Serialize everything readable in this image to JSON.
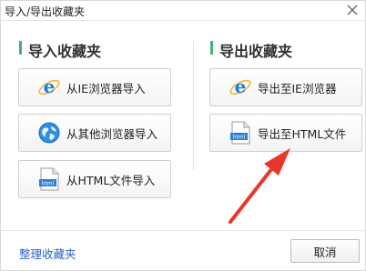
{
  "window": {
    "title": "导入/导出收藏夹"
  },
  "import_section": {
    "title": "导入收藏夹",
    "buttons": [
      {
        "label": "从IE浏览器导入",
        "icon": "ie-browser-icon"
      },
      {
        "label": "从其他浏览器导入",
        "icon": "globe-icon"
      },
      {
        "label": "从HTML文件导入",
        "icon": "html-file-icon"
      }
    ]
  },
  "export_section": {
    "title": "导出收藏夹",
    "buttons": [
      {
        "label": "导出至IE浏览器",
        "icon": "ie-browser-icon"
      },
      {
        "label": "导出至HTML文件",
        "icon": "html-file-icon"
      }
    ]
  },
  "footer": {
    "manage_link": "整理收藏夹",
    "cancel_label": "取消"
  },
  "file_icon_text": "html",
  "colors": {
    "section_accent": "#3cb371",
    "link": "#2b62c8",
    "annotation_arrow": "#e8372c",
    "ie_blue": "#1f7fd6"
  }
}
